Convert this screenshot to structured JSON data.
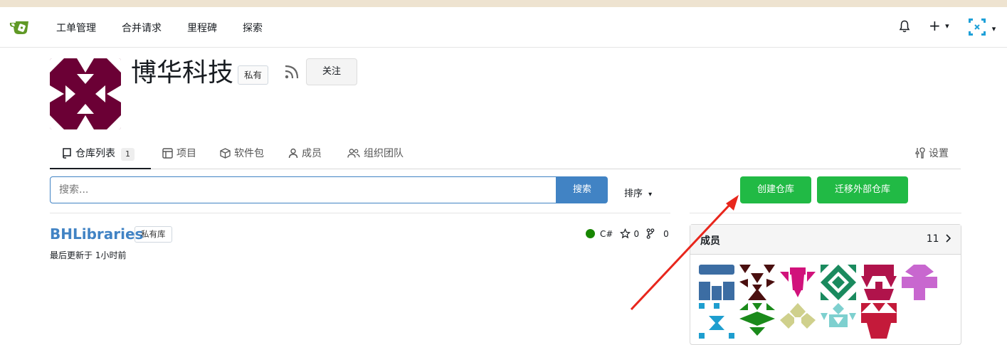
{
  "navbar": {
    "items": [
      "工单管理",
      "合并请求",
      "里程碑",
      "探索"
    ],
    "add_label": "+",
    "caret": "▾"
  },
  "org": {
    "name": "博华科技",
    "visibility": "私有",
    "follow_label": "关注"
  },
  "tabs": [
    {
      "label": "仓库列表",
      "count": "1"
    },
    {
      "label": "项目"
    },
    {
      "label": "软件包"
    },
    {
      "label": "成员"
    },
    {
      "label": "组织团队"
    },
    {
      "label": "设置"
    }
  ],
  "search": {
    "placeholder": "搜索...",
    "button_label": "搜索",
    "sort_label": "排序"
  },
  "actions": {
    "create_repo": "创建仓库",
    "migrate_repo": "迁移外部仓库"
  },
  "repos": [
    {
      "name": "BHLibraries",
      "badge": "私有库",
      "updated": "最后更新于 1小时前",
      "language": "C#",
      "language_color": "#178600",
      "stars": "0",
      "forks": "0"
    }
  ],
  "members": {
    "title": "成员",
    "count": "11"
  },
  "colors": {
    "accent_blue": "#4183c4",
    "green": "#21ba45",
    "annotation_red": "#e8261c",
    "org_avatar": "#6b0035"
  }
}
